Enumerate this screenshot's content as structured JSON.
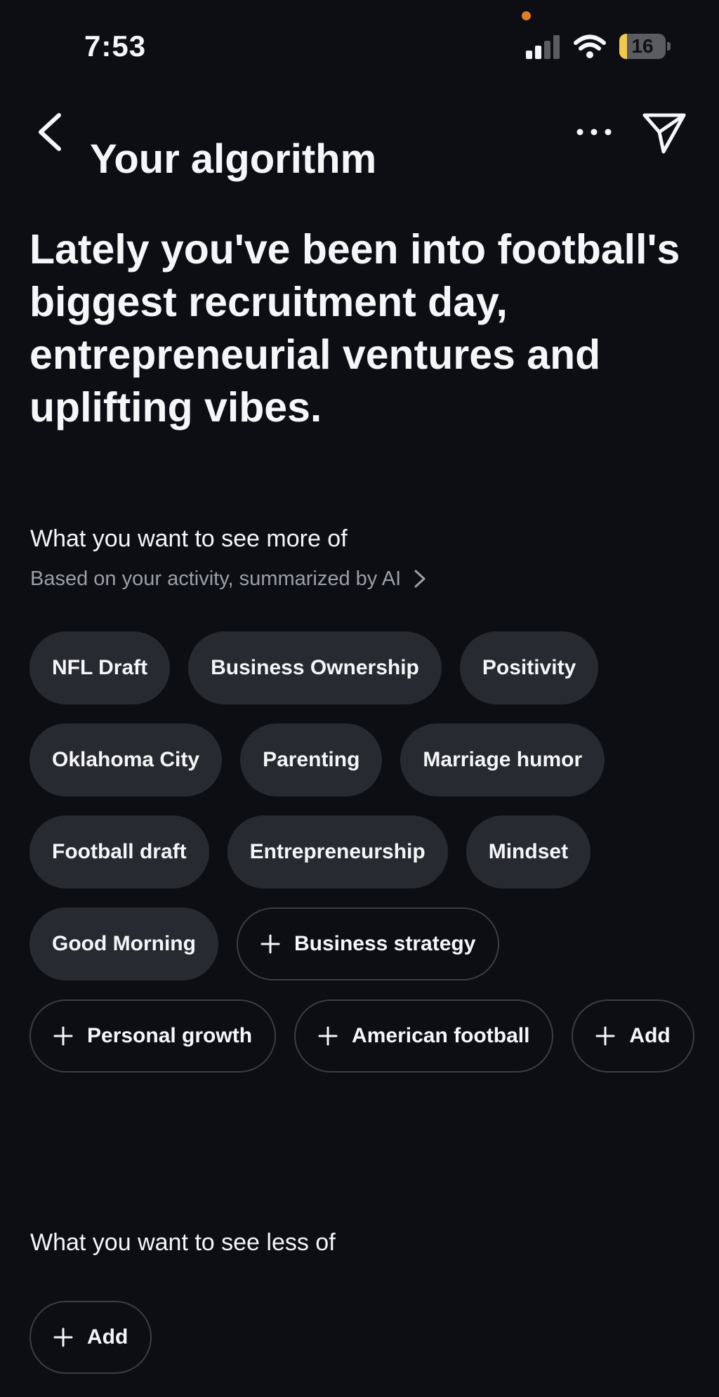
{
  "colors": {
    "background": "#0c0e14",
    "chip_filled": "#272a31",
    "chip_border": "#3a3d45",
    "text_primary": "#f5f6f8",
    "text_secondary": "#9b9fa8",
    "privacy_dot": "#e07b2a",
    "battery_fill": "#f2c94c"
  },
  "status_bar": {
    "time": "7:53",
    "battery_level": "16",
    "battery_fraction": 0.16,
    "icons": [
      "signal-icon",
      "wifi-icon",
      "battery-icon"
    ]
  },
  "header": {
    "title": "Your algorithm",
    "icons": [
      "chevron-left-icon",
      "ellipsis-icon",
      "send-icon"
    ]
  },
  "headline": "Lately you've been into football's biggest recruitment day, entrepreneurial ventures and uplifting vibes.",
  "see_more": {
    "title": "What you want to see more of",
    "subtitle": "Based on your activity, summarized by AI",
    "topics": [
      "NFL Draft",
      "Business Ownership",
      "Positivity",
      "Oklahoma City",
      "Parenting",
      "Marriage humor",
      "Football draft",
      "Entrepreneurship",
      "Mindset",
      "Good Morning"
    ],
    "suggestions": [
      "Business strategy",
      "Personal growth",
      "American football"
    ],
    "add_label": "Add"
  },
  "see_less": {
    "title": "What you want to see less of",
    "add_label": "Add"
  }
}
